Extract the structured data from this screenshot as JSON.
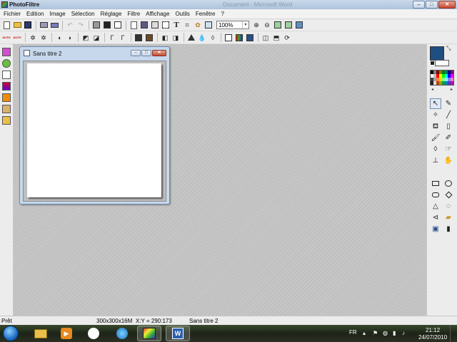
{
  "app": {
    "title": "PhotoFiltre",
    "ghost_title": "Document - Microsoft Word"
  },
  "window_controls": {
    "minimize": "–",
    "maximize": "□",
    "close": "✕"
  },
  "menu": [
    "Fichier",
    "Edition",
    "Image",
    "Sélection",
    "Réglage",
    "Filtre",
    "Affichage",
    "Outils",
    "Fenêtre",
    "?"
  ],
  "toolbar": {
    "zoom_value": "100%",
    "zoom_arrow": "▾",
    "text_tool": "T",
    "auto_label_1": "AUTO",
    "auto_label_2": "AUTO"
  },
  "document": {
    "title": "Sans titre 2"
  },
  "colors": {
    "foreground": "#1f4f80",
    "background": "#ffffff",
    "accent": "#6f8bb0"
  },
  "palette": [
    "#000000",
    "#808080",
    "#800000",
    "#808000",
    "#008000",
    "#008080",
    "#000080",
    "#800080",
    "#ffffff",
    "#c0c0c0",
    "#ff0000",
    "#ffff00",
    "#00ff00",
    "#00ffff",
    "#0000ff",
    "#ff00ff",
    "#404040",
    "#a0a0a0",
    "#ff8040",
    "#ffd000",
    "#80ff80",
    "#80ffff",
    "#8080ff",
    "#ff80c0",
    "#202020",
    "#e0e0e0",
    "#c04000",
    "#a0a000",
    "#00a040",
    "#0080c0",
    "#4040c0",
    "#c000c0"
  ],
  "palette_nav": {
    "prev": "◂",
    "next": "▸"
  },
  "status": {
    "state": "Prêt",
    "dimensions": "300x300x16M",
    "coords": "X:Y = 290:173",
    "filename": "Sans titre 2"
  },
  "taskbar": {
    "language": "FR",
    "time": "21:12",
    "date": "24/07/2010"
  }
}
